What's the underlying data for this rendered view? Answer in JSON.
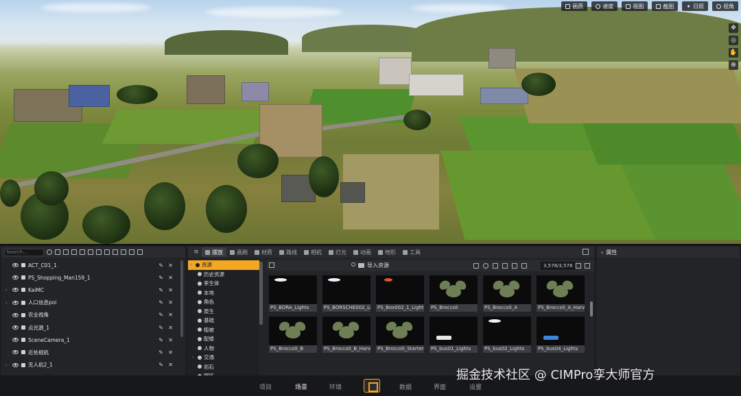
{
  "viewport_toolbar": [
    {
      "label": "画质",
      "icon": "quality-icon"
    },
    {
      "label": "速度",
      "icon": "speed-icon"
    },
    {
      "label": "视图",
      "icon": "view-icon"
    },
    {
      "label": "截图",
      "icon": "screenshot-icon"
    },
    {
      "label": "日照",
      "icon": "sun-icon"
    },
    {
      "label": "视角",
      "icon": "eye-icon"
    }
  ],
  "outliner": {
    "search_placeholder": "Search...",
    "items": [
      {
        "name": "ACT_C01_1",
        "expandable": false
      },
      {
        "name": "PS_Shopping_Man159_1",
        "expandable": false
      },
      {
        "name": "KaiMC",
        "expandable": true
      },
      {
        "name": "人口信息poi",
        "expandable": true
      },
      {
        "name": "农业视角",
        "expandable": false
      },
      {
        "name": "点光源_1",
        "expandable": false
      },
      {
        "name": "SceneCamera_1",
        "expandable": false
      },
      {
        "name": "近处相机",
        "expandable": false
      },
      {
        "name": "无人机2_1",
        "expandable": true
      }
    ]
  },
  "content_tabs": [
    {
      "label": "摆放",
      "active": true
    },
    {
      "label": "画刷",
      "active": false
    },
    {
      "label": "材质",
      "active": false
    },
    {
      "label": "路线",
      "active": false
    },
    {
      "label": "相机",
      "active": false
    },
    {
      "label": "灯光",
      "active": false
    },
    {
      "label": "动画",
      "active": false
    },
    {
      "label": "地形",
      "active": false
    },
    {
      "label": "工具",
      "active": false
    }
  ],
  "asset_tree": [
    {
      "label": "资源",
      "selected": true,
      "arrow": "▾"
    },
    {
      "label": "历史资源",
      "selected": false,
      "arrow": ""
    },
    {
      "label": "孪生体",
      "selected": false,
      "arrow": ""
    },
    {
      "label": "本地",
      "selected": false,
      "arrow": ""
    },
    {
      "label": "角色",
      "selected": false,
      "arrow": ""
    },
    {
      "label": "原生",
      "selected": false,
      "arrow": ""
    },
    {
      "label": "基础",
      "selected": false,
      "arrow": ""
    },
    {
      "label": "植被",
      "selected": false,
      "arrow": ""
    },
    {
      "label": "配楼",
      "selected": false,
      "arrow": ""
    },
    {
      "label": "人物",
      "selected": false,
      "arrow": ""
    },
    {
      "label": "交通",
      "selected": false,
      "arrow": "›"
    },
    {
      "label": "岩石",
      "selected": false,
      "arrow": ""
    },
    {
      "label": "园区",
      "selected": false,
      "arrow": ""
    }
  ],
  "asset_bar": {
    "import_label": "导入资源",
    "count": "3,578/3,578"
  },
  "assets": [
    {
      "label": "PS_BORA_Lights",
      "kind": "light-white"
    },
    {
      "label": "PS_BORSCHE002_Li",
      "kind": "light-white"
    },
    {
      "label": "PS_Box002_1_Lights",
      "kind": "light-red"
    },
    {
      "label": "PS_Broccoli",
      "kind": "plant"
    },
    {
      "label": "PS_Broccoli_A",
      "kind": "plant"
    },
    {
      "label": "PS_Broccoli_A_Harv",
      "kind": "plant"
    },
    {
      "label": "PS_Broccoli_B",
      "kind": "plant"
    },
    {
      "label": "PS_Broccoli_B_Harv",
      "kind": "plant"
    },
    {
      "label": "PS_Broccoli_Starter",
      "kind": "plant"
    },
    {
      "label": "PS_bus01_Lights",
      "kind": "bus-white"
    },
    {
      "label": "PS_bus02_Lights",
      "kind": "light-white"
    },
    {
      "label": "PS_bus04_Lights",
      "kind": "bus-blue"
    }
  ],
  "properties": {
    "title": "属性"
  },
  "bottom_tabs": [
    {
      "label": "项目",
      "active": false
    },
    {
      "label": "场景",
      "active": true
    },
    {
      "label": "环境",
      "active": false
    },
    {
      "label": "数据",
      "active": false
    },
    {
      "label": "界面",
      "active": false
    },
    {
      "label": "设置",
      "active": false
    }
  ],
  "watermark": "掘金技术社区 @ CIMPro孪大师官方",
  "colors": {
    "accent": "#f5a623",
    "panel": "#232427",
    "selected_row": "#f5a623"
  }
}
